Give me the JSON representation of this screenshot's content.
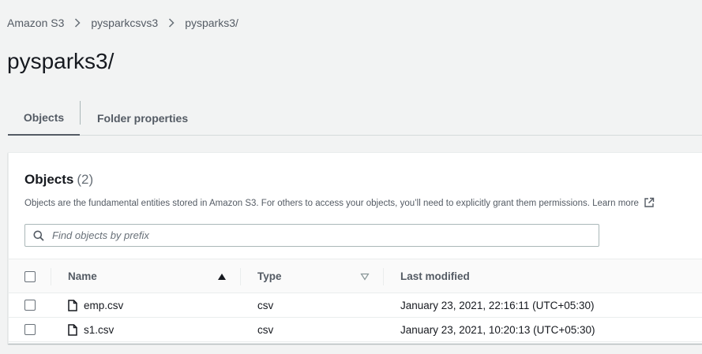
{
  "breadcrumb": {
    "items": [
      "Amazon S3",
      "pysparkcsvs3",
      "pysparks3/"
    ]
  },
  "page": {
    "title": "pysparks3/"
  },
  "tabs": [
    {
      "label": "Objects",
      "active": true
    },
    {
      "label": "Folder properties",
      "active": false
    }
  ],
  "objects_panel": {
    "title": "Objects",
    "count": "(2)",
    "description": "Objects are the fundamental entities stored in Amazon S3. For others to access your objects, you’ll need to explicitly grant them permissions.",
    "learn_more": "Learn more",
    "search_placeholder": "Find objects by prefix",
    "search_value": ""
  },
  "table": {
    "columns": {
      "name": "Name",
      "type": "Type",
      "last_modified": "Last modified"
    },
    "rows": [
      {
        "name": "emp.csv",
        "type": "csv",
        "last_modified": "January 23, 2021, 22:16:11 (UTC+05:30)"
      },
      {
        "name": "s1.csv",
        "type": "csv",
        "last_modified": "January 23, 2021, 10:20:13 (UTC+05:30)"
      }
    ]
  },
  "icons": {
    "chevron": "chevron-right-icon",
    "search": "search-icon",
    "file": "file-icon",
    "external": "external-link-icon",
    "sort_asc": "sort-ascending-icon",
    "sort_desc": "sort-descending-icon"
  },
  "colors": {
    "background": "#f2f3f3",
    "panel": "#ffffff",
    "text": "#16191f",
    "muted": "#545b64"
  }
}
